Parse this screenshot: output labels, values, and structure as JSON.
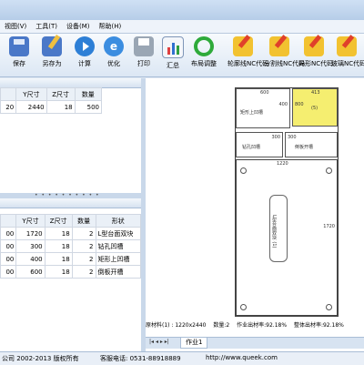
{
  "menu": {
    "items": [
      "视图(V)",
      "工具(T)",
      "设备(M)",
      "帮助(H)"
    ]
  },
  "toolbar": {
    "buttons": [
      {
        "label": "保存",
        "icon": "save-icon"
      },
      {
        "label": "另存为",
        "icon": "save-as-icon"
      },
      {
        "label": "计算",
        "icon": "calculate-icon"
      },
      {
        "label": "优化",
        "icon": "optimize-icon"
      },
      {
        "label": "打印",
        "icon": "print-icon"
      },
      {
        "label": "汇总",
        "icon": "summary-icon"
      },
      {
        "label": "布局调整",
        "icon": "refresh-icon"
      },
      {
        "label": "轮廓线NC代码",
        "icon": "nc-pencil-icon"
      },
      {
        "label": "分割线NC代码",
        "icon": "nc-pencil-icon"
      },
      {
        "label": "异形NC代码",
        "icon": "nc-pencil-icon"
      },
      {
        "label": "玻璃NC代码",
        "icon": "nc-pencil-icon"
      }
    ]
  },
  "top_table": {
    "headers": [
      "",
      "Y尺寸",
      "Z尺寸",
      "数量"
    ],
    "rows": [
      [
        "20",
        "2440",
        "18",
        "500"
      ]
    ]
  },
  "bottom_table": {
    "headers": [
      "",
      "Y尺寸",
      "Z尺寸",
      "数量",
      "形状"
    ],
    "rows": [
      [
        "00",
        "1720",
        "18",
        "2",
        "L型台面双块"
      ],
      [
        "00",
        "300",
        "18",
        "2",
        "钻孔凹槽"
      ],
      [
        "00",
        "400",
        "18",
        "2",
        "矩形上凹槽"
      ],
      [
        "00",
        "600",
        "18",
        "2",
        "倒板开槽"
      ]
    ]
  },
  "layout": {
    "parts": [
      {
        "label": "矩形上凹槽",
        "dim_top": "600",
        "dim_side": "400"
      },
      {
        "label": "(5)",
        "dim_top": "413",
        "dim_side": "800"
      },
      {
        "label": "钻孔凹槽",
        "dim_side": "300"
      },
      {
        "label": "倒板开槽",
        "dim_side": "300"
      },
      {
        "label": "L型台面双块 (1)",
        "dim_top": "1220",
        "dim_side": "1720"
      }
    ],
    "info": {
      "material": "原材料(1) : 1220x2440",
      "quantity": "数量:2",
      "yield": "作业出材率:92.18%",
      "overall": "整体出材率:92.18%"
    }
  },
  "tabs": {
    "arrows": "|◂ ◂ ▸ ▸|",
    "active": "作业1"
  },
  "statusbar": {
    "copyright": "公司  2002-2013 版权所有",
    "phone": "客服电话: 0531-88918889",
    "website": "http://www.queek.com"
  }
}
